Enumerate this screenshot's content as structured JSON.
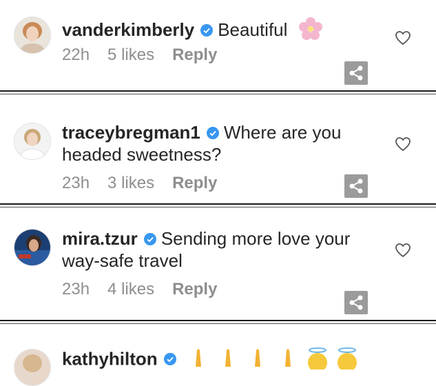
{
  "comments": [
    {
      "username": "vanderkimberly",
      "text": "Beautiful",
      "emoji": "flower",
      "time": "22h",
      "likes": "5 likes",
      "reply": "Reply"
    },
    {
      "username": "traceybregman1",
      "text": "Where are you headed sweetness?",
      "time": "23h",
      "likes": "3 likes",
      "reply": "Reply"
    },
    {
      "username": "mira.tzur",
      "text": "Sending more love your way-safe travel",
      "time": "23h",
      "likes": "4 likes",
      "reply": "Reply"
    },
    {
      "username": "kathyhilton",
      "text": "",
      "emoji": "praying-hands, angel-faces"
    }
  ],
  "icons": {
    "verified": "verified-badge-icon",
    "heart": "heart-icon",
    "share": "share-icon"
  },
  "colors": {
    "verified_blue": "#3897f0",
    "meta_gray": "#8e8e8e",
    "share_bg": "#9b9b9b"
  }
}
